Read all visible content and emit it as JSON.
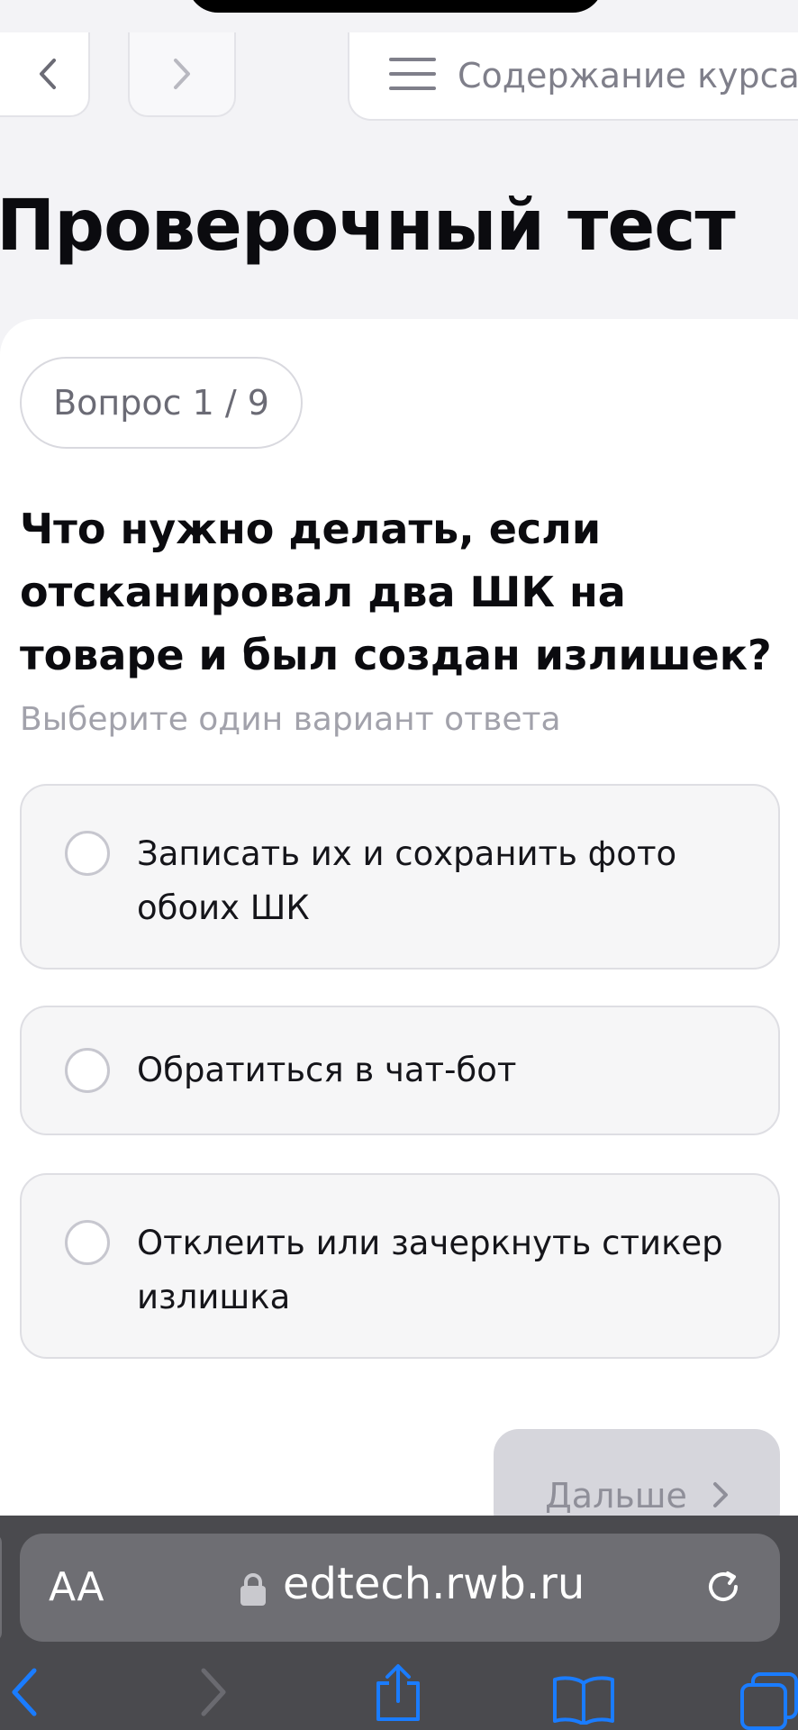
{
  "top_nav": {
    "course_contents_label": "Содержание курса"
  },
  "page_title": "Проверочный тест",
  "quiz": {
    "question_counter": "Вопрос 1 / 9",
    "question_text": "Что нужно делать, если отсканировал два ШК на товаре и был создан излишек?",
    "hint": "Выберите один вариант ответа",
    "options": [
      {
        "label": "Записать их и сохранить фото обоих ШК",
        "selected": false
      },
      {
        "label": "Обратиться в чат-бот",
        "selected": false
      },
      {
        "label": "Отклеить или зачеркнуть стикер излишка",
        "selected": false
      }
    ],
    "next_label": "Дальше"
  },
  "browser": {
    "text_size_label": "AA",
    "url": "edtech.rwb.ru",
    "icons": [
      "back-icon",
      "forward-icon",
      "share-icon",
      "bookmarks-icon",
      "tabs-icon",
      "lock-icon",
      "reload-icon"
    ]
  },
  "colors": {
    "page_bg": "#f3f3f6",
    "card_bg": "#ffffff",
    "option_bg": "#f6f6f7",
    "button_disabled": "#d6d6dc",
    "safari_bar": "#4a4a4e",
    "safari_accent": "#1a7cff"
  }
}
